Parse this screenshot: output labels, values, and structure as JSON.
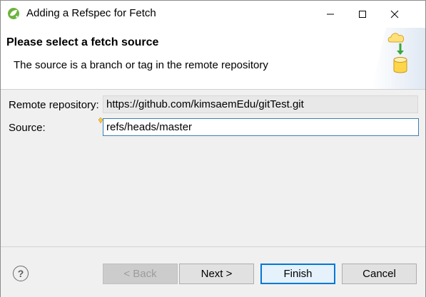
{
  "window": {
    "title": "Adding a Refspec for Fetch"
  },
  "banner": {
    "title": "Please select a fetch source",
    "description": "The source is a branch or tag in the remote repository",
    "graphic": "cloud-download-database-icon"
  },
  "form": {
    "remote_label": "Remote repository:",
    "remote_value": "https://github.com/kimsaemEdu/gitTest.git",
    "source_label": "Source:",
    "source_value": "refs/heads/master"
  },
  "buttons": {
    "help": "?",
    "back": "< Back",
    "next": "Next >",
    "finish": "Finish",
    "cancel": "Cancel"
  },
  "colors": {
    "focus_border": "#0078d7",
    "field_focus": "#3c7fb1",
    "content_bg": "#f0f0f0"
  }
}
